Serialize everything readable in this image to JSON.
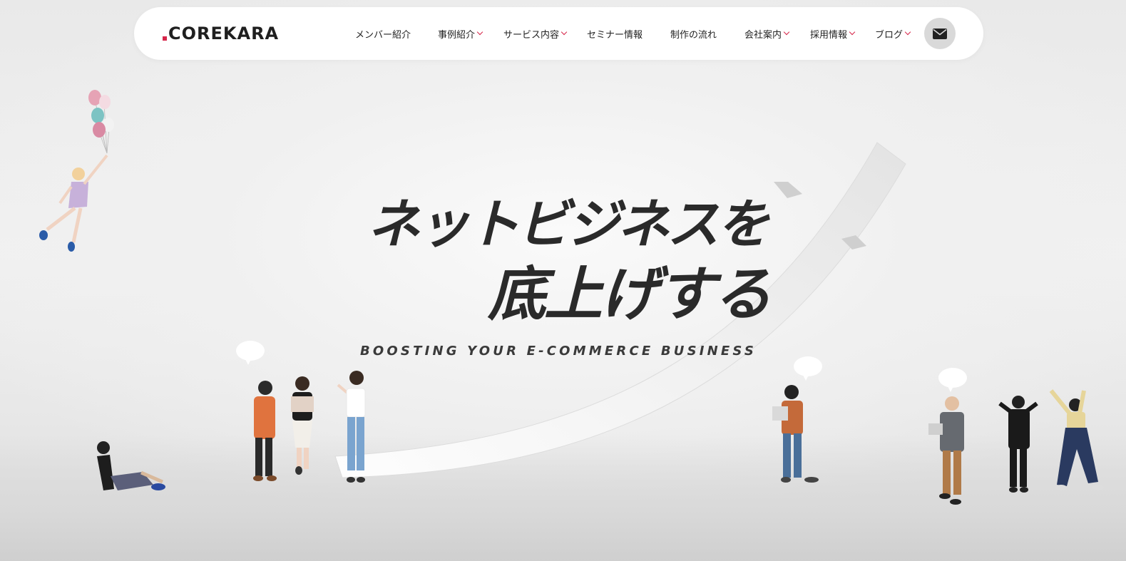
{
  "brand": {
    "logo_text": "COREKARA",
    "accent_color": "#d6264a"
  },
  "nav": {
    "items": [
      {
        "label": "メンバー紹介",
        "has_dropdown": false
      },
      {
        "label": "事例紹介",
        "has_dropdown": true
      },
      {
        "label": "サービス内容",
        "has_dropdown": true
      },
      {
        "label": "セミナー情報",
        "has_dropdown": false
      },
      {
        "label": "制作の流れ",
        "has_dropdown": false
      },
      {
        "label": "会社案内",
        "has_dropdown": true
      },
      {
        "label": "採用情報",
        "has_dropdown": true
      },
      {
        "label": "ブログ",
        "has_dropdown": true
      }
    ],
    "mail_icon": "envelope-icon"
  },
  "hero": {
    "headline_line1": "ネットビジネスを",
    "headline_line2": "底上げする",
    "subtitle": "BOOSTING YOUR E-COMMERCE BUSINESS"
  }
}
